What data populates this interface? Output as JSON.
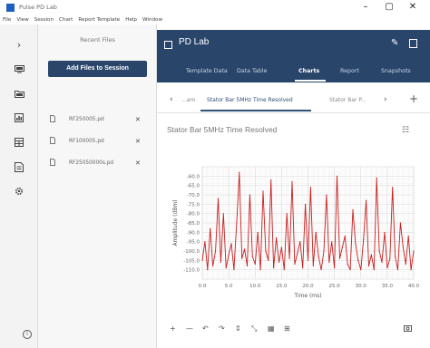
{
  "window": {
    "title": "Pulse PD Lab",
    "controls": [
      "–",
      "▢",
      "✕"
    ]
  },
  "menu": [
    "File",
    "View",
    "Session",
    "Chart",
    "Report Template",
    "Help",
    "Window"
  ],
  "rail": {
    "collapse_glyph": "›",
    "icons": [
      "monitor-icon",
      "folder-icon",
      "dashboard-icon",
      "table-icon",
      "report-icon",
      "settings-icon",
      "info-icon"
    ]
  },
  "files_panel": {
    "title": "Recent Files",
    "add_button": "Add Files to Session",
    "files": [
      {
        "name": "RF250005.pd",
        "icon": "file-icon"
      },
      {
        "name": "RF100005.pd",
        "icon": "file-icon"
      },
      {
        "name": "RF25050000s.pd",
        "icon": "file-icon"
      }
    ]
  },
  "main": {
    "title": "PD Lab",
    "tabs": [
      "Template Data",
      "Data Table",
      "Charts",
      "Report",
      "Snapshots"
    ],
    "active_tab": "Charts"
  },
  "subtabs": {
    "items": [
      "...am",
      "Stator Bar 5MHz Time Resolved",
      "Stator Bar P..."
    ],
    "active": "Stator Bar 5MHz Time Resolved"
  },
  "chart": {
    "title": "Stator Bar 5MHz Time Resolved"
  },
  "chart_data": {
    "type": "line",
    "xlabel": "Time (ms)",
    "ylabel": "Amplitude (dBm)",
    "xlim": [
      0,
      40
    ],
    "ylim": [
      -115,
      -55
    ],
    "xticks": [
      "0.0",
      "5.0",
      "10.0",
      "15.0",
      "20.0",
      "25.0",
      "30.0",
      "35.0",
      "40.0"
    ],
    "yticks": [
      "-60.0",
      "-65.0",
      "-70.0",
      "-75.0",
      "-80.0",
      "-85.0",
      "-90.0",
      "-95.0",
      "-100.0",
      "-105.0",
      "-110.0"
    ],
    "grid": true,
    "series": [
      {
        "color": "#c81e1e",
        "x": [
          0,
          0.5,
          1,
          1.5,
          2,
          2.5,
          3,
          3.5,
          4,
          4.5,
          5,
          5.5,
          6,
          6.5,
          7,
          7.5,
          8,
          8.5,
          9,
          9.5,
          10,
          10.5,
          11,
          11.5,
          12,
          12.5,
          13,
          13.5,
          14,
          14.5,
          15,
          15.5,
          16,
          16.5,
          17,
          17.5,
          18,
          18.5,
          19,
          19.5,
          20,
          20.5,
          21,
          21.5,
          22,
          22.5,
          23,
          23.5,
          24,
          24.5,
          25,
          25.5,
          26,
          26.5,
          27,
          27.5,
          28,
          28.5,
          29,
          29.5,
          30,
          30.5,
          31,
          31.5,
          32,
          32.5,
          33,
          33.5,
          34,
          34.5,
          35,
          35.5,
          36,
          36.5,
          37,
          37.5,
          38,
          38.5,
          39,
          39.5,
          40
        ],
        "y": [
          -105,
          -95,
          -110,
          -88,
          -108,
          -100,
          -72,
          -106,
          -80,
          -109,
          -102,
          -96,
          -110,
          -85,
          -58,
          -104,
          -99,
          -108,
          -70,
          -103,
          -107,
          -90,
          -110,
          -68,
          -100,
          -105,
          -62,
          -109,
          -93,
          -106,
          -98,
          -110,
          -80,
          -104,
          -63,
          -107,
          -101,
          -95,
          -109,
          -75,
          -105,
          -66,
          -108,
          -90,
          -103,
          -110,
          -100,
          -70,
          -106,
          -95,
          -109,
          -60,
          -104,
          -98,
          -92,
          -107,
          -110,
          -78,
          -96,
          -105,
          -110,
          -94,
          -73,
          -108,
          -102,
          -110,
          -61,
          -100,
          -106,
          -90,
          -109,
          -104,
          -66,
          -103,
          -110,
          -85,
          -98,
          -107,
          -92,
          -110,
          -100
        ]
      }
    ]
  },
  "toolbar": {
    "buttons": [
      "+",
      "—",
      "↶",
      "↷",
      "⇕",
      "⤡",
      "▦",
      "⊞"
    ],
    "camera_icon": "camera-icon"
  },
  "colors": {
    "header": "#29456a",
    "accent": "#2d4f7a",
    "series": "#c81e1e"
  }
}
